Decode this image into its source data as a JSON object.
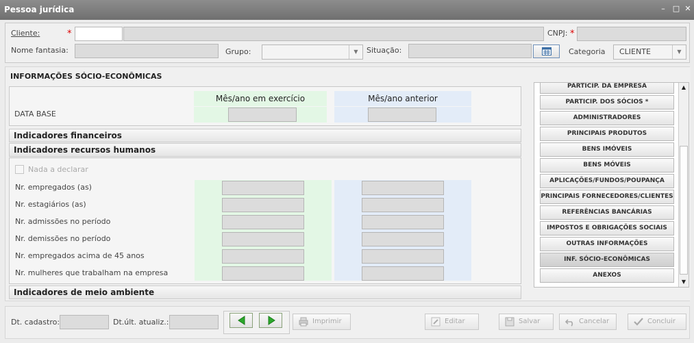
{
  "window": {
    "title": "Pessoa jurídica"
  },
  "header": {
    "cliente_label": "Cliente:",
    "cnpj_label": "CNPJ:",
    "nome_fantasia_label": "Nome fantasia:",
    "grupo_label": "Grupo:",
    "situacao_label": "Situação:",
    "categoria_label": "Categoria",
    "categoria_value": "CLIENTE",
    "required_mark": "*"
  },
  "main": {
    "section_title": "INFORMAÇÕES SÓCIO-ECONÔMICAS",
    "col_current": "Mês/ano em exercício",
    "col_previous": "Mês/ano anterior",
    "data_base_label": "DATA BASE",
    "sections": {
      "financeiros": "Indicadores financeiros",
      "recursos_humanos": "Indicadores recursos humanos",
      "meio_ambiente": "Indicadores de meio ambiente"
    },
    "nada_a_declarar": "Nada a declarar",
    "rows": [
      "Nr. empregados (as)",
      "Nr. estagiários (as)",
      "Nr. admissões no período",
      "Nr. demissões no período",
      "Nr. empregados acima de 45 anos",
      "Nr. mulheres que trabalham na empresa"
    ]
  },
  "nav": {
    "items": [
      "PARTICIP. DA EMPRESA",
      "PARTICIP. DOS SÓCIOS *",
      "ADMINISTRADORES",
      "PRINCIPAIS PRODUTOS",
      "BENS IMÓVEIS",
      "BENS MÓVEIS",
      "APLICAÇÕES/FUNDOS/POUPANÇA",
      "PRINCIPAIS FORNECEDORES/CLIENTES",
      "REFERÊNCIAS BANCÁRIAS",
      "IMPOSTOS E OBRIGAÇÕES SOCIAIS",
      "OUTRAS INFORMAÇÕES",
      "INF. SÓCIO-ECONÔMICAS",
      "ANEXOS"
    ],
    "active_index": 11
  },
  "footer": {
    "dt_cadastro_label": "Dt. cadastro:",
    "dt_ult_label": "Dt.últ. atualiz.:",
    "imprimir": "Imprimir",
    "editar": "Editar",
    "salvar": "Salvar",
    "cancelar": "Cancelar",
    "concluir": "Concluir"
  },
  "colors": {
    "titlebar": "#7a7a7a",
    "current_col": "#e3f7e5",
    "previous_col": "#e3ecf8",
    "nav_green": "#2aa82a"
  }
}
